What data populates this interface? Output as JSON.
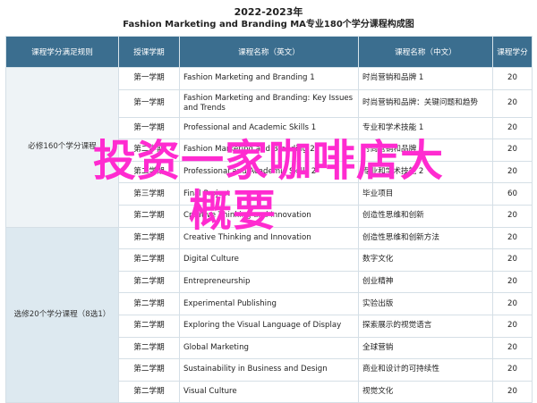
{
  "header": {
    "year": "2022-2023年",
    "subtitle": "Fashion Marketing and Branding MA专业180个学分课程构成图"
  },
  "table": {
    "columns": [
      "课程学分满足规则",
      "授课学期",
      "课程名称（英文）",
      "课程名称（中文）",
      "课程学分"
    ],
    "groups": [
      {
        "rule": "必修160个学分课程",
        "start": 0,
        "span": 7
      },
      {
        "rule": "选修20个学分课程（8选1）",
        "start": 7,
        "span": 8
      }
    ],
    "rows": [
      {
        "semester": "第一学期",
        "en": "Fashion Marketing and Branding 1",
        "cn": "时尚营销和品牌 1",
        "credits": "20"
      },
      {
        "semester": "第一学期",
        "en": "Fashion Marketing and Branding: Key Issues and Trends",
        "cn": "时尚营销和品牌：关键问题和趋势",
        "credits": "20"
      },
      {
        "semester": "第一学期",
        "en": "Professional and Academic Skills 1",
        "cn": "专业和学术技能 1",
        "credits": "20"
      },
      {
        "semester": "第二学期",
        "en": "Fashion Marketing and Branding 2",
        "cn": "时尚营销和品牌 2",
        "credits": "20"
      },
      {
        "semester": "第二学期",
        "en": "Professional and Academic Skills 2",
        "cn": "专业和学术技能 2",
        "credits": "20"
      },
      {
        "semester": "第三学期",
        "en": "Final Project",
        "cn": "毕业项目",
        "credits": "60"
      },
      {
        "semester": "第二学期",
        "en": "Creative Thinking and Innovation",
        "cn": "创造性思维和创新",
        "credits": "20"
      },
      {
        "semester": "第二学期",
        "en": "Creative Thinking and Innovation",
        "cn": "创造性思维和创新方法",
        "credits": "20"
      },
      {
        "semester": "第二学期",
        "en": "Digital Culture",
        "cn": "数字文化",
        "credits": "20"
      },
      {
        "semester": "第二学期",
        "en": "Entrepreneurship",
        "cn": "创业精神",
        "credits": "20"
      },
      {
        "semester": "第二学期",
        "en": "Experimental Publishing",
        "cn": "实验出版",
        "credits": "20"
      },
      {
        "semester": "第二学期",
        "en": "Exploring the Visual Language of Display",
        "cn": "探索展示的视觉语言",
        "credits": "20"
      },
      {
        "semester": "第二学期",
        "en": "Global Marketing",
        "cn": "全球营销",
        "credits": "20"
      },
      {
        "semester": "第二学期",
        "en": "Sustainability in Business and Design",
        "cn": "商业和设计的可持续性",
        "credits": "20"
      },
      {
        "semester": "第二学期",
        "en": "Visual Culture",
        "cn": "视觉文化",
        "credits": "20"
      }
    ]
  },
  "overlay": {
    "line1": "投资一家咖啡店大",
    "line2": "概要",
    "color": "#ff2bd0"
  }
}
